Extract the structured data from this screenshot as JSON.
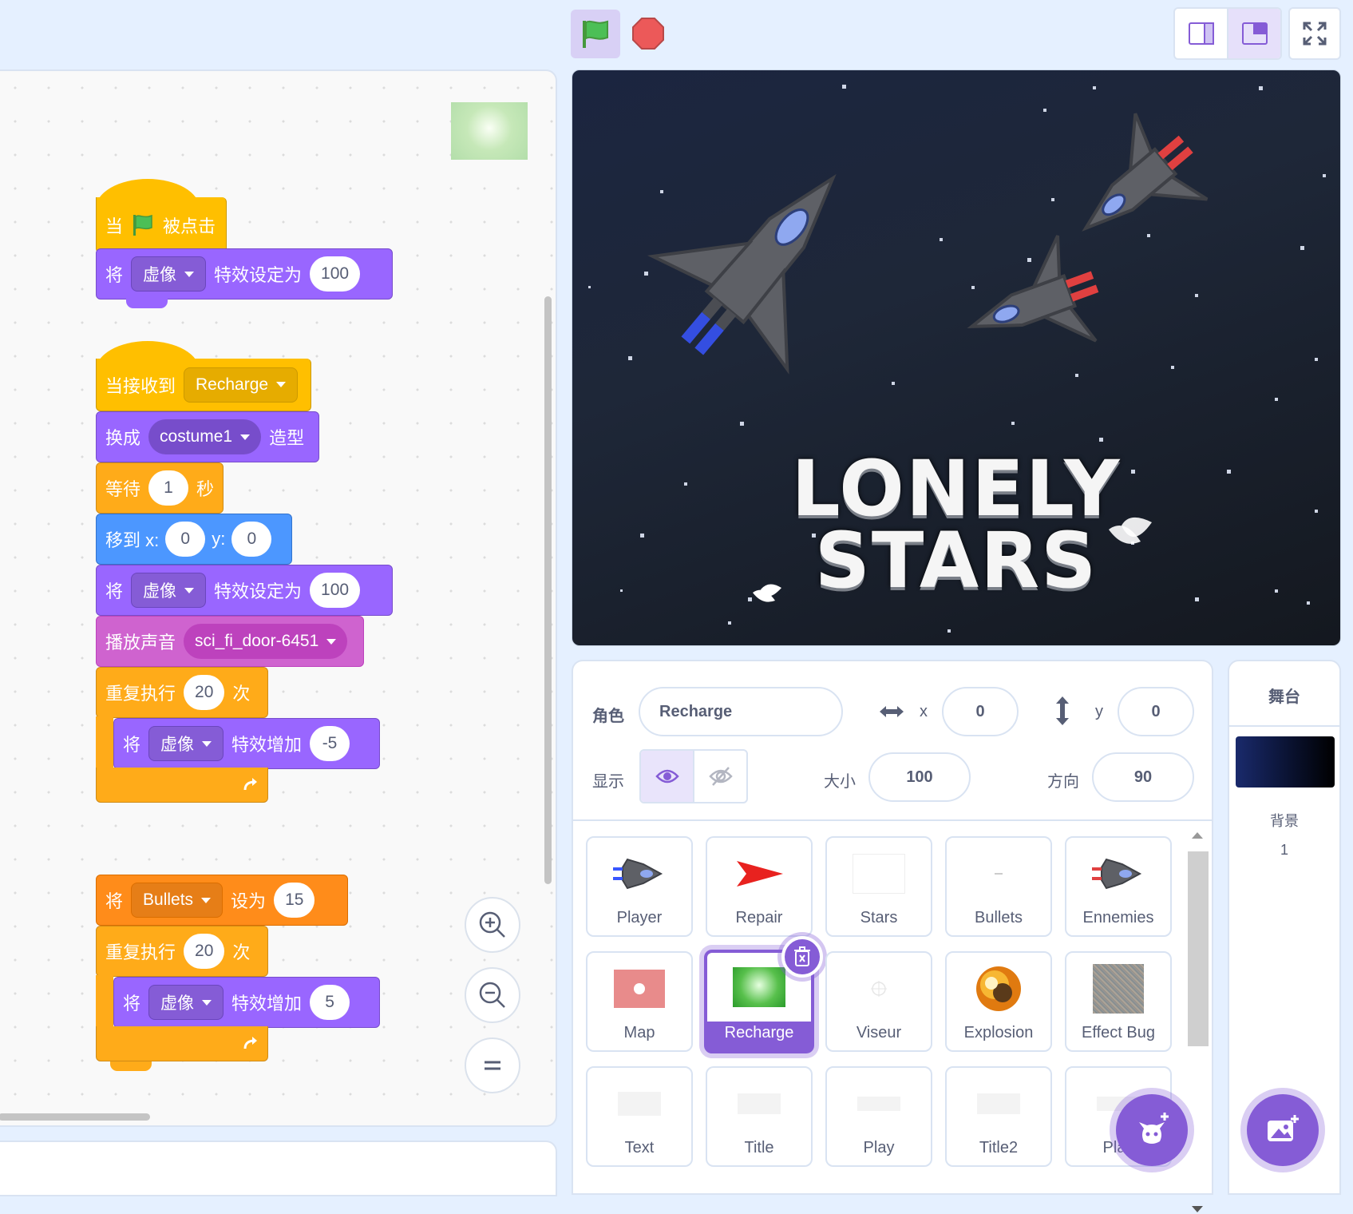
{
  "code_area": {
    "script1": {
      "hat_when": "当",
      "hat_clicked": "被点击",
      "set_effect": {
        "prefix": "将",
        "effect": "虚像",
        "suffix": "特效设定为",
        "value": "100"
      }
    },
    "script2": {
      "hat_receive": "当接收到",
      "hat_message": "Recharge",
      "switch_costume": {
        "prefix": "换成",
        "costume": "costume1",
        "suffix": "造型"
      },
      "wait": {
        "prefix": "等待",
        "value": "1",
        "suffix": "秒"
      },
      "goto": {
        "prefix": "移到 x:",
        "x": "0",
        "ylabel": "y:",
        "y": "0"
      },
      "set_effect": {
        "prefix": "将",
        "effect": "虚像",
        "suffix": "特效设定为",
        "value": "100"
      },
      "play_sound": {
        "prefix": "播放声音",
        "sound": "sci_fi_door-6451"
      },
      "repeat1": {
        "prefix": "重复执行",
        "value": "20",
        "suffix": "次"
      },
      "change1": {
        "prefix": "将",
        "effect": "虚像",
        "suffix": "特效增加",
        "value": "-5"
      },
      "set_var": {
        "prefix": "将",
        "variable": "Bullets",
        "suffix": "设为",
        "value": "15"
      },
      "repeat2": {
        "prefix": "重复执行",
        "value": "20",
        "suffix": "次"
      },
      "change2": {
        "prefix": "将",
        "effect": "虚像",
        "suffix": "特效增加",
        "value": "5"
      }
    }
  },
  "stage": {
    "title_line1": "LONELY",
    "title_line2": "STARS"
  },
  "sprite_info": {
    "sprite_label": "角色",
    "sprite_name": "Recharge",
    "x_label": "x",
    "x_value": "0",
    "y_label": "y",
    "y_value": "0",
    "show_label": "显示",
    "size_label": "大小",
    "size_value": "100",
    "direction_label": "方向",
    "direction_value": "90"
  },
  "sprites": [
    {
      "name": "Player"
    },
    {
      "name": "Repair"
    },
    {
      "name": "Stars"
    },
    {
      "name": "Bullets"
    },
    {
      "name": "Ennemies"
    },
    {
      "name": "Map"
    },
    {
      "name": "Recharge",
      "selected": true
    },
    {
      "name": "Viseur"
    },
    {
      "name": "Explosion"
    },
    {
      "name": "Effect Bug"
    },
    {
      "name": "Text"
    },
    {
      "name": "Title"
    },
    {
      "name": "Play"
    },
    {
      "name": "Title2"
    },
    {
      "name": "Play"
    }
  ],
  "stage_panel": {
    "title": "舞台",
    "backdrop_label": "背景",
    "backdrop_count": "1"
  },
  "colors": {
    "looks": "#9966ff",
    "events": "#ffbf00",
    "control": "#ffab19",
    "motion": "#4c97ff",
    "sound": "#cf63cf",
    "variables": "#ff8c1a",
    "accent": "#855cd6"
  }
}
